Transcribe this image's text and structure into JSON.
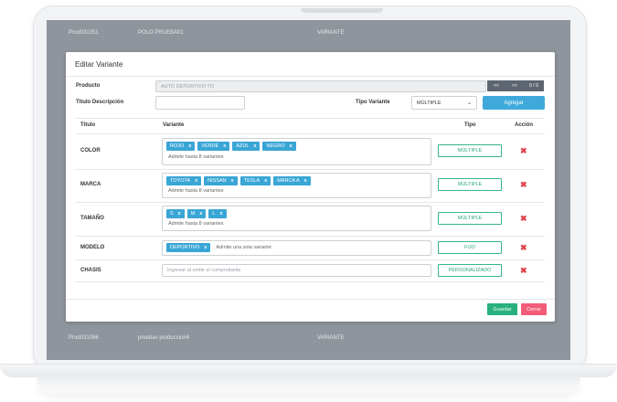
{
  "background": {
    "row_top": {
      "code": "Prod031351",
      "name": "POLO PRUEBA01",
      "type": "VARIANTE"
    },
    "row_bottom": {
      "code": "Prod031096",
      "name": "pruebas produccion4",
      "type": "VARIANTE"
    }
  },
  "modal": {
    "title": "Editar Variante",
    "producto_label": "Producto",
    "producto_value": "AUTO DEPORTIVO TO",
    "nav_prev": "<<",
    "nav_next": ">>",
    "nav_count": "0 / 0",
    "titulo_label": "Titulo Descripción",
    "tipo_variante_label": "Tipo Variante",
    "tipo_variante_value": "MÚLTIPLE",
    "agregar_label": "Agregar",
    "table": {
      "headers": {
        "titulo": "Titulo",
        "variante": "Variante",
        "tipo": "Tipo",
        "accion": "Acción"
      },
      "rows": [
        {
          "titulo": "COLOR",
          "tags": [
            "ROJO",
            "VERDE",
            "AZUL",
            "NEGRO"
          ],
          "hint": "Admite hasta 8 variantes",
          "tipo": "MÚLTIPLE"
        },
        {
          "titulo": "MARCA",
          "tags": [
            "TOYOTA",
            "NISSAN",
            "TESLA",
            "MARCA A"
          ],
          "hint": "Admite hasta 8 variantes",
          "tipo": "MÚLTIPLE"
        },
        {
          "titulo": "TAMAÑO",
          "tags": [
            "S",
            "M",
            "L"
          ],
          "hint": "Admite hasta 8 variantes",
          "tipo": "MÚLTIPLE"
        },
        {
          "titulo": "MODELO",
          "tags": [
            "DEPORTIVO"
          ],
          "hint": "Admite una sola variante",
          "tipo": "FIJO"
        },
        {
          "titulo": "CHASIS",
          "tags": [],
          "placeholder": "Ingresar al emitir el comprobante",
          "tipo": "PERSONALIZADO"
        }
      ],
      "delete_symbol": "✖",
      "tag_remove": "x"
    },
    "guardar_label": "Guardar",
    "cerrar_label": "Cerrar"
  },
  "colors": {
    "accent": "#3aa6d6",
    "success": "#28b07f",
    "danger": "#e0424b",
    "cancel": "#f25c78"
  }
}
